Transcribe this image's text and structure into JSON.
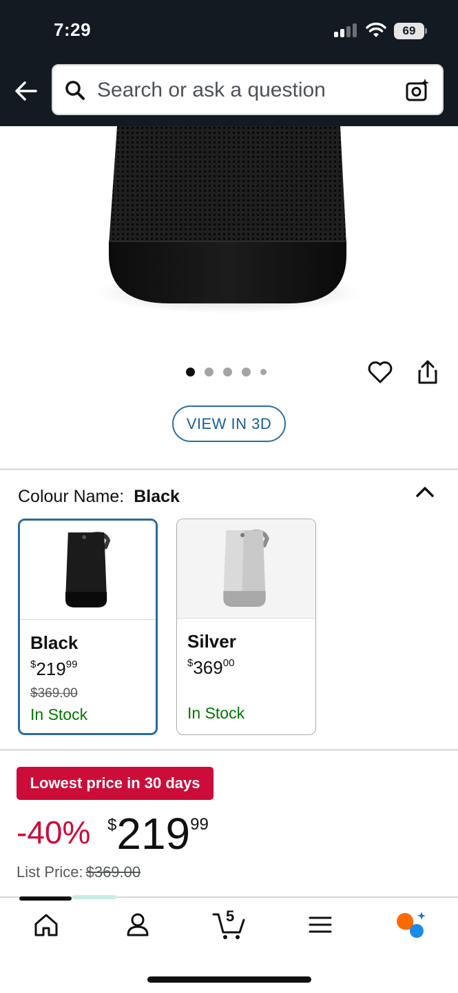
{
  "status_bar": {
    "time": "7:29",
    "battery": "69"
  },
  "search": {
    "placeholder": "Search or ask a question"
  },
  "gallery": {
    "image_count": 5,
    "active_index": 0
  },
  "view_3d_label": "VIEW IN 3D",
  "colour": {
    "label": "Colour Name:",
    "selected": "Black",
    "options": [
      {
        "name": "Black",
        "price_whole": "219",
        "price_cents": "99",
        "price_currency": "$",
        "list_price": "$369.00",
        "stock": "In Stock",
        "selected": true
      },
      {
        "name": "Silver",
        "price_whole": "369",
        "price_cents": "00",
        "price_currency": "$",
        "stock": "In Stock",
        "selected": false
      }
    ]
  },
  "deal": {
    "badge": "Lowest price in 30 days",
    "discount": "-40%",
    "currency": "$",
    "price_whole": "219",
    "price_cents": "99",
    "list_price_label": "List Price:",
    "list_price": "$369.00"
  },
  "tabbar": {
    "cart_count": "5"
  },
  "colors": {
    "header_bg": "#131a22",
    "deal_red": "#cc0c39",
    "stock_green": "#007600",
    "link_blue": "#2a6aa0"
  }
}
